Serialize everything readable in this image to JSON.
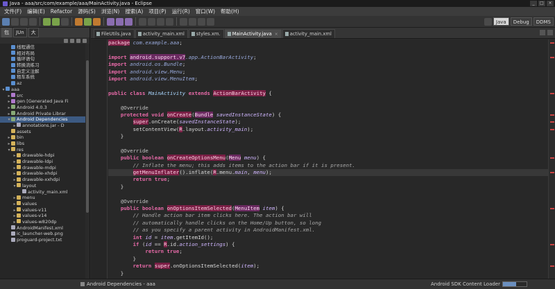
{
  "window": {
    "title": "Java - aaa/src/com/example/aaa/MainActivity.java - Eclipse"
  },
  "menu": [
    "文件(F)",
    "编辑(E)",
    "Refactor",
    "源码(S)",
    "浏览(N)",
    "搜索(A)",
    "项目(P)",
    "运行(R)",
    "窗口(W)",
    "帮助(H)"
  ],
  "perspectives": [
    {
      "label": "Java",
      "active": true
    },
    {
      "label": "Debug",
      "active": false
    },
    {
      "label": "DDMS",
      "active": false
    }
  ],
  "left_tabs": [
    {
      "label": "包",
      "active": true
    },
    {
      "label": "JUn",
      "active": false
    },
    {
      "label": "大",
      "active": false
    }
  ],
  "tree": [
    {
      "indent": 1,
      "twisty": "",
      "icon": "proj",
      "label": "线程通信"
    },
    {
      "indent": 1,
      "twisty": "",
      "icon": "proj",
      "label": "相对布局"
    },
    {
      "indent": 1,
      "twisty": "",
      "icon": "proj",
      "label": "循环语句"
    },
    {
      "indent": 1,
      "twisty": "",
      "icon": "proj",
      "label": "转换流练习"
    },
    {
      "indent": 1,
      "twisty": "",
      "icon": "proj",
      "label": "自定义注解"
    },
    {
      "indent": 1,
      "twisty": "",
      "icon": "proj",
      "label": "租车系统"
    },
    {
      "indent": 1,
      "twisty": "",
      "icon": "proj",
      "label": "az"
    },
    {
      "indent": 0,
      "twisty": "▾",
      "icon": "proj",
      "label": "aaa"
    },
    {
      "indent": 1,
      "twisty": "▸",
      "icon": "src",
      "label": "src"
    },
    {
      "indent": 1,
      "twisty": "▸",
      "icon": "src",
      "label": "gen [Generated Java Fi"
    },
    {
      "indent": 1,
      "twisty": "▸",
      "icon": "lib",
      "label": "Android 4.0.3"
    },
    {
      "indent": 1,
      "twisty": "▸",
      "icon": "lib",
      "label": "Android Private Librar"
    },
    {
      "indent": 1,
      "twisty": "▾",
      "icon": "lib",
      "label": "Android Dependencies",
      "selected": true
    },
    {
      "indent": 2,
      "twisty": "▸",
      "icon": "file",
      "label": "annotations.jar - D"
    },
    {
      "indent": 1,
      "twisty": "",
      "icon": "folder",
      "label": "assets"
    },
    {
      "indent": 1,
      "twisty": "▸",
      "icon": "folder",
      "label": "bin"
    },
    {
      "indent": 1,
      "twisty": "▸",
      "icon": "folder",
      "label": "libs"
    },
    {
      "indent": 1,
      "twisty": "▾",
      "icon": "folder",
      "label": "res"
    },
    {
      "indent": 2,
      "twisty": "▸",
      "icon": "folder",
      "label": "drawable-hdpi"
    },
    {
      "indent": 2,
      "twisty": "▸",
      "icon": "folder",
      "label": "drawable-ldpi"
    },
    {
      "indent": 2,
      "twisty": "▸",
      "icon": "folder",
      "label": "drawable-mdpi"
    },
    {
      "indent": 2,
      "twisty": "▸",
      "icon": "folder",
      "label": "drawable-xhdpi"
    },
    {
      "indent": 2,
      "twisty": "▸",
      "icon": "folder",
      "label": "drawable-xxhdpi"
    },
    {
      "indent": 2,
      "twisty": "▾",
      "icon": "folder",
      "label": "layout"
    },
    {
      "indent": 3,
      "twisty": "",
      "icon": "file",
      "label": "activity_main.xml"
    },
    {
      "indent": 2,
      "twisty": "▸",
      "icon": "folder",
      "label": "menu"
    },
    {
      "indent": 2,
      "twisty": "▸",
      "icon": "folder",
      "label": "values"
    },
    {
      "indent": 2,
      "twisty": "▸",
      "icon": "folder",
      "label": "values-v11"
    },
    {
      "indent": 2,
      "twisty": "▸",
      "icon": "folder",
      "label": "values-v14"
    },
    {
      "indent": 2,
      "twisty": "▸",
      "icon": "folder",
      "label": "values-w820dp"
    },
    {
      "indent": 1,
      "twisty": "",
      "icon": "file",
      "label": "AndroidManifest.xml"
    },
    {
      "indent": 1,
      "twisty": "",
      "icon": "file",
      "label": "ic_launcher-web.png"
    },
    {
      "indent": 1,
      "twisty": "",
      "icon": "file",
      "label": "proguard-project.txt"
    }
  ],
  "editor_tabs": [
    {
      "label": "FileUtils.java",
      "active": false
    },
    {
      "label": "activity_main.xml",
      "active": false
    },
    {
      "label": "styles.xm.",
      "active": false
    },
    {
      "label": "MainActivity.java",
      "active": true
    },
    {
      "label": "activity_main.xml",
      "active": false
    }
  ],
  "code": [
    {
      "n": "1",
      "marker": true,
      "fold": "",
      "html": "<span class=\"hl\">package</span> <span class=\"p\">com.example.aaa</span>;"
    },
    {
      "n": "2",
      "html": ""
    },
    {
      "n": "3",
      "marker": true,
      "fold": "+",
      "html": "<span class=\"k\">import</span> <span class=\"hl2\">android.support.v7</span><span class=\"p\">.app.ActionBarActivity</span>;"
    },
    {
      "n": "4",
      "html": "<span class=\"k\">import</span> <span class=\"p\">android.os.Bundle</span>;"
    },
    {
      "n": "5",
      "html": "<span class=\"k\">import</span> <span class=\"p\">android.view.Menu</span>;"
    },
    {
      "n": "6",
      "html": "<span class=\"k\">import</span> <span class=\"p\">android.view.MenuItem</span>;"
    },
    {
      "n": "7",
      "html": ""
    },
    {
      "n": "8",
      "marker": true,
      "html": "<span class=\"k\">public class</span> <span class=\"t\">MainActivity</span> <span class=\"k\">extends</span> <span class=\"hl\">ActionBarActivity</span> {"
    },
    {
      "n": "9",
      "html": ""
    },
    {
      "n": "10",
      "fold": "-",
      "html": "    <span class=\"a\">@Override</span>"
    },
    {
      "n": "11",
      "marker": true,
      "html": "    <span class=\"k\">protected void</span> <span class=\"hl\">onCreate</span>(<span class=\"hl2\">Bundle</span> <span class=\"v\">savedInstanceState</span>) {"
    },
    {
      "n": "12",
      "marker": true,
      "html": "        <span class=\"hl\">super</span>.onCreate(<span class=\"v\">savedInstanceState</span>);"
    },
    {
      "n": "13",
      "marker": true,
      "html": "        setContentView(<span class=\"hl\">R</span>.layout.<span class=\"v\">activity_main</span>);"
    },
    {
      "n": "14",
      "html": "    }"
    },
    {
      "n": "15",
      "html": ""
    },
    {
      "n": "16",
      "fold": "-",
      "html": "    <span class=\"a\">@Override</span>"
    },
    {
      "n": "17",
      "marker": true,
      "html": "    <span class=\"k\">public boolean</span> <span class=\"hl\">onCreateOptionsMenu</span>(<span class=\"hl2\">Menu</span> <span class=\"v\">menu</span>) {"
    },
    {
      "n": "18",
      "html": "        <span class=\"c\">// Inflate the menu; this adds items to the action bar if it is present.</span>"
    },
    {
      "n": "19",
      "marker": true,
      "current": true,
      "html": "        <span class=\"hl\">getMenuInflater</span>().inflate(<span class=\"hl\">R</span>.menu.<span class=\"v\">main</span>, <span class=\"v\">menu</span>);"
    },
    {
      "n": "20",
      "html": "        <span class=\"k\">return true</span>;"
    },
    {
      "n": "21",
      "html": "    }"
    },
    {
      "n": "22",
      "html": ""
    },
    {
      "n": "23",
      "fold": "-",
      "html": "    <span class=\"a\">@Override</span>"
    },
    {
      "n": "24",
      "marker": true,
      "html": "    <span class=\"k\">public boolean</span> <span class=\"hl\">onOptionsItemSelected</span>(<span class=\"hl2\">MenuItem</span> <span class=\"v\">item</span>) {"
    },
    {
      "n": "25",
      "html": "        <span class=\"c\">// Handle action bar item clicks here. The action bar will</span>"
    },
    {
      "n": "26",
      "html": "        <span class=\"c\">// automatically handle clicks on the Home/Up button, so long</span>"
    },
    {
      "n": "27",
      "html": "        <span class=\"c\">// as you specify a parent activity in AndroidManifest.xml.</span>"
    },
    {
      "n": "28",
      "html": "        <span class=\"k\">int</span> <span class=\"v\">id</span> = <span class=\"v\">item</span>.getItemId();"
    },
    {
      "n": "29",
      "marker": true,
      "html": "        <span class=\"k\">if</span> (<span class=\"v\">id</span> == <span class=\"hl\">R</span>.id.<span class=\"v\">action_settings</span>) {"
    },
    {
      "n": "30",
      "html": "            <span class=\"k\">return true</span>;"
    },
    {
      "n": "31",
      "html": "        }"
    },
    {
      "n": "32",
      "marker": true,
      "html": "        <span class=\"k\">return</span> <span class=\"hl\">super</span>.onOptionsItemSelected(<span class=\"v\">item</span>);"
    },
    {
      "n": "33",
      "html": "    }"
    }
  ],
  "status": {
    "left": "Android Dependencies - aaa",
    "right": "Android SDK Content Loader",
    "progress": 0.55
  }
}
